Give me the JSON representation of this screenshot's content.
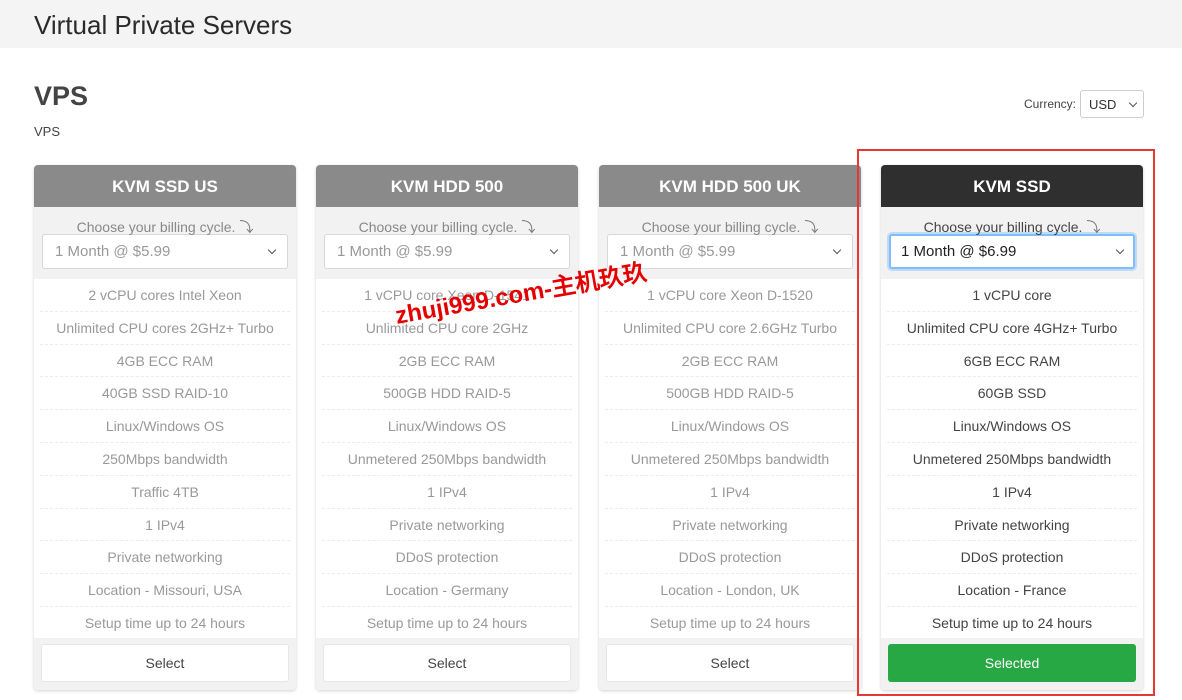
{
  "header": {
    "title": "Virtual Private Servers"
  },
  "section": {
    "title": "VPS",
    "subtitle": "VPS"
  },
  "currency": {
    "label": "Currency:",
    "value": "USD"
  },
  "billing_label": "Choose your billing cycle.",
  "plans": [
    {
      "name": "KVM SSD US",
      "cycle": "1 Month @ $5.99",
      "features": [
        "2 vCPU cores Intel Xeon",
        "Unlimited CPU cores 2GHz+ Turbo",
        "4GB ECC RAM",
        "40GB SSD RAID-10",
        "Linux/Windows OS",
        "250Mbps bandwidth",
        "Traffic 4TB",
        "1 IPv4",
        "Private networking",
        "Location - Missouri, USA",
        "Setup time up to 24 hours"
      ],
      "button": "Select"
    },
    {
      "name": "KVM HDD 500",
      "cycle": "1 Month @ $5.99",
      "features": [
        "1 vCPU core Xeon D-1541",
        "Unlimited CPU core 2GHz",
        "2GB ECC RAM",
        "500GB HDD RAID-5",
        "Linux/Windows OS",
        "Unmetered 250Mbps bandwidth",
        "1 IPv4",
        "Private networking",
        "DDoS protection",
        "Location - Germany",
        "Setup time up to 24 hours"
      ],
      "button": "Select"
    },
    {
      "name": "KVM HDD 500 UK",
      "cycle": "1 Month @ $5.99",
      "features": [
        "1 vCPU core Xeon D-1520",
        "Unlimited CPU core 2.6GHz Turbo",
        "2GB ECC RAM",
        "500GB HDD RAID-5",
        "Linux/Windows OS",
        "Unmetered 250Mbps bandwidth",
        "1 IPv4",
        "Private networking",
        "DDoS protection",
        "Location - London, UK",
        "Setup time up to 24 hours"
      ],
      "button": "Select"
    },
    {
      "name": "KVM SSD",
      "cycle": "1 Month @ $6.99",
      "features": [
        "1 vCPU core",
        "Unlimited CPU core 4GHz+ Turbo",
        "6GB ECC RAM",
        "60GB SSD",
        "Linux/Windows OS",
        "Unmetered 250Mbps bandwidth",
        "1 IPv4",
        "Private networking",
        "DDoS protection",
        "Location - France",
        "Setup time up to 24 hours"
      ],
      "button": "Selected"
    }
  ],
  "watermark": "zhuji999.com-主机玖玖",
  "colors": {
    "selected_green": "#28a745",
    "highlight_red": "#e53935",
    "header_gray": "#8a8a8a",
    "header_dark": "#2f2f2f"
  }
}
